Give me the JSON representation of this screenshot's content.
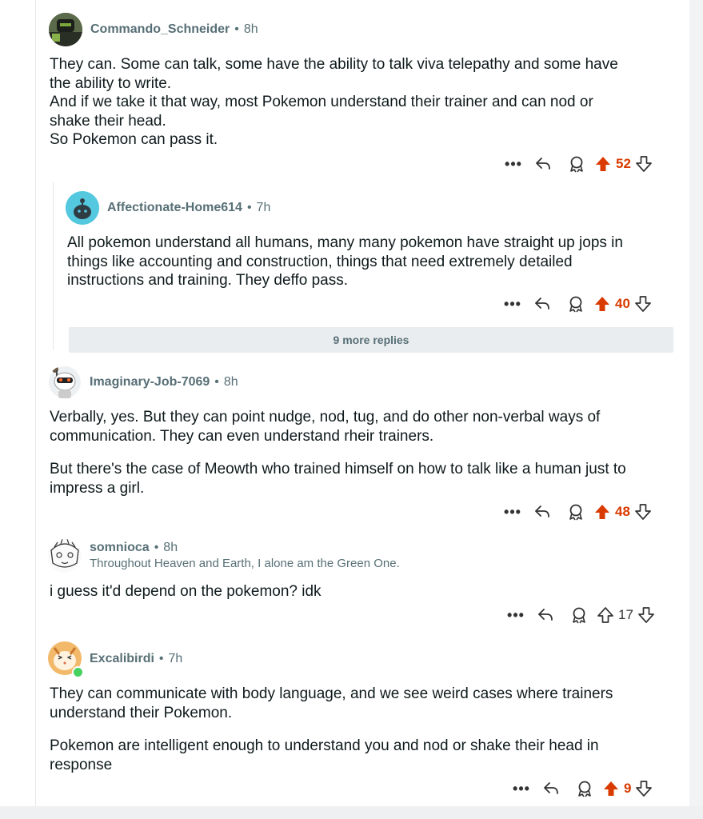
{
  "comments": [
    {
      "author": "Commando_Schneider",
      "time": "8h",
      "paragraphs": [
        [
          "They can. Some can talk, some have the ability to talk viva telepathy and some have",
          "the ability to write.",
          "And if we take it that way, most Pokemon understand their trainer and can nod or",
          "shake their head.",
          "So Pokemon can pass it."
        ]
      ],
      "score": "52",
      "upvoted": true
    },
    {
      "author": "Affectionate-Home614",
      "time": "7h",
      "paragraphs": [
        [
          "All pokemon understand all humans, many many pokemon have straight up jops in",
          "things like accounting and construction, things that need extremely detailed",
          "instructions and training. They deffo pass."
        ]
      ],
      "score": "40",
      "upvoted": true
    },
    {
      "author": "Imaginary-Job-7069",
      "time": "8h",
      "paragraphs": [
        [
          "Verbally, yes. But they can point nudge, nod, tug, and do other non-verbal ways of",
          "communication. They can even understand rheir trainers."
        ],
        [
          "But there's the case of Meowth who trained himself on how to talk like a human just to",
          "impress a girl."
        ]
      ],
      "score": "48",
      "upvoted": true
    },
    {
      "author": "somnioca",
      "time": "8h",
      "flair": "Throughout Heaven and Earth, I alone am the Green One.",
      "paragraphs": [
        [
          "i guess it'd depend on the pokemon? idk"
        ]
      ],
      "score": "17",
      "upvoted": false
    },
    {
      "author": "Excalibirdi",
      "time": "7h",
      "paragraphs": [
        [
          "They can communicate with body language, and we see weird cases where trainers",
          "understand their Pokemon."
        ],
        [
          "Pokemon are intelligent enough to understand you and nod or shake their head in",
          "response"
        ]
      ],
      "score": "9",
      "upvoted": true
    }
  ],
  "more_replies_label": "9 more replies",
  "colors": {
    "upvote_active": "#d93a00",
    "meta_text": "#576f76",
    "more_replies_bg": "#eaedef",
    "online_dot": "#46d160"
  },
  "icons": [
    "more-icon",
    "reply-icon",
    "award-icon",
    "upvote-icon",
    "downvote-icon"
  ]
}
